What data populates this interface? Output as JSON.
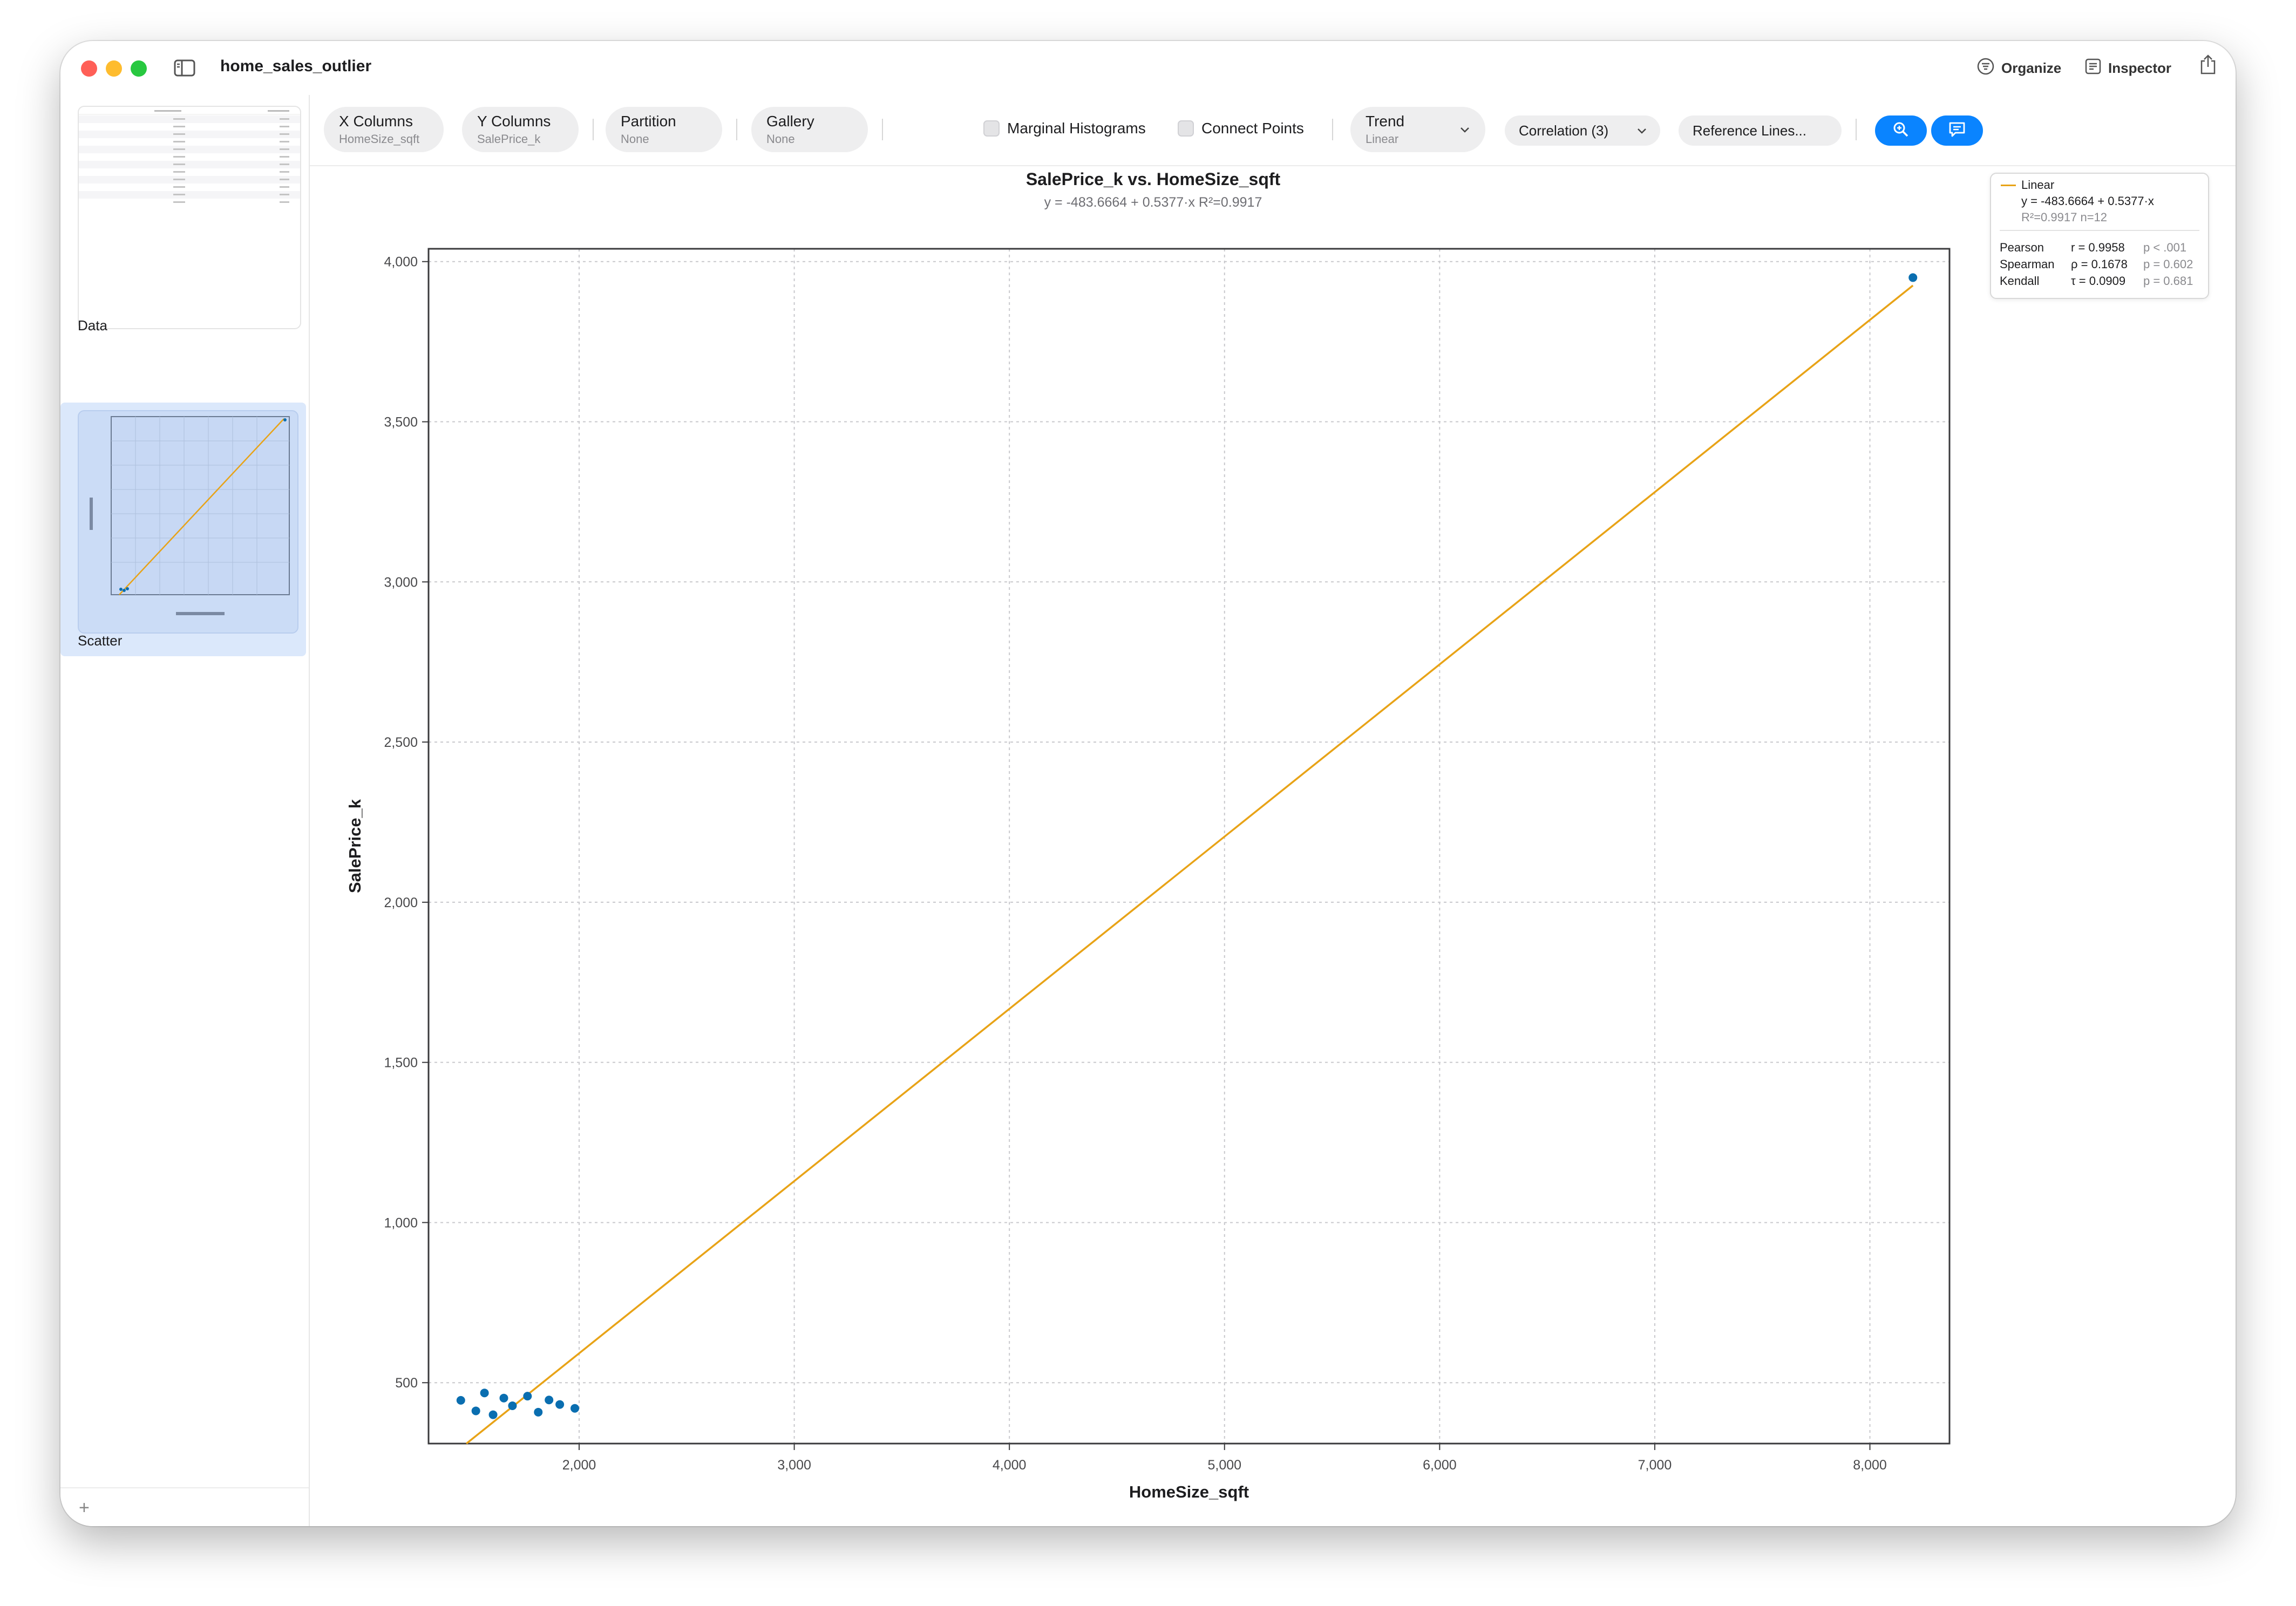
{
  "window": {
    "title": "home_sales_outlier"
  },
  "titlebar": {
    "organize_label": "Organize",
    "inspector_label": "Inspector"
  },
  "sidebar": {
    "items": [
      {
        "label": "Data",
        "selected": false
      },
      {
        "label": "Scatter",
        "selected": true
      }
    ],
    "add_label": "+"
  },
  "toolbar": {
    "x_columns": {
      "label": "X Columns",
      "value": "HomeSize_sqft"
    },
    "y_columns": {
      "label": "Y Columns",
      "value": "SalePrice_k"
    },
    "partition": {
      "label": "Partition",
      "value": "None"
    },
    "gallery": {
      "label": "Gallery",
      "value": "None"
    },
    "marginal_histograms": {
      "label": "Marginal Histograms",
      "checked": false
    },
    "connect_points": {
      "label": "Connect Points",
      "checked": false
    },
    "trend": {
      "label": "Trend",
      "value": "Linear"
    },
    "correlation_label": "Correlation (3)",
    "reference_lines_label": "Reference Lines..."
  },
  "legend": {
    "fit_name": "Linear",
    "equation": "y = -483.6664 + 0.5377·x",
    "stats": "R²=0.9917  n=12",
    "rows": [
      {
        "method": "Pearson",
        "coef": "r = 0.9958",
        "p": "p < .001"
      },
      {
        "method": "Spearman",
        "coef": "ρ = 0.1678",
        "p": "p = 0.602"
      },
      {
        "method": "Kendall",
        "coef": "τ = 0.0909",
        "p": "p = 0.681"
      }
    ]
  },
  "colors": {
    "accent": "#0a84ff",
    "points": "#0a6eb0",
    "trend": "#e8a317"
  },
  "chart_data": {
    "type": "scatter",
    "title": "SalePrice_k vs. HomeSize_sqft",
    "subtitle": "y = -483.6664 + 0.5377·x   R²=0.9917",
    "xlabel": "HomeSize_sqft",
    "ylabel": "SalePrice_k",
    "xlim": [
      1300,
      8370
    ],
    "ylim": [
      310,
      4040
    ],
    "xticks": [
      2000,
      3000,
      4000,
      5000,
      6000,
      7000,
      8000
    ],
    "xtick_labels": [
      "2,000",
      "3,000",
      "4,000",
      "5,000",
      "6,000",
      "7,000",
      "8,000"
    ],
    "yticks": [
      500,
      1000,
      1500,
      2000,
      2500,
      3000,
      3500,
      4000
    ],
    "ytick_labels": [
      "500",
      "1,000",
      "1,500",
      "2,000",
      "2,500",
      "3,000",
      "3,500",
      "4,000"
    ],
    "grid": true,
    "series": [
      {
        "x": [
          1450,
          1520,
          1560,
          1600,
          1650,
          1690,
          1760,
          1810,
          1860,
          1910,
          1980,
          8200
        ],
        "y": [
          445,
          412,
          468,
          400,
          452,
          428,
          458,
          408,
          446,
          432,
          420,
          3950
        ]
      }
    ],
    "trend": {
      "type": "linear",
      "intercept": -483.6664,
      "slope": 0.5377
    }
  }
}
